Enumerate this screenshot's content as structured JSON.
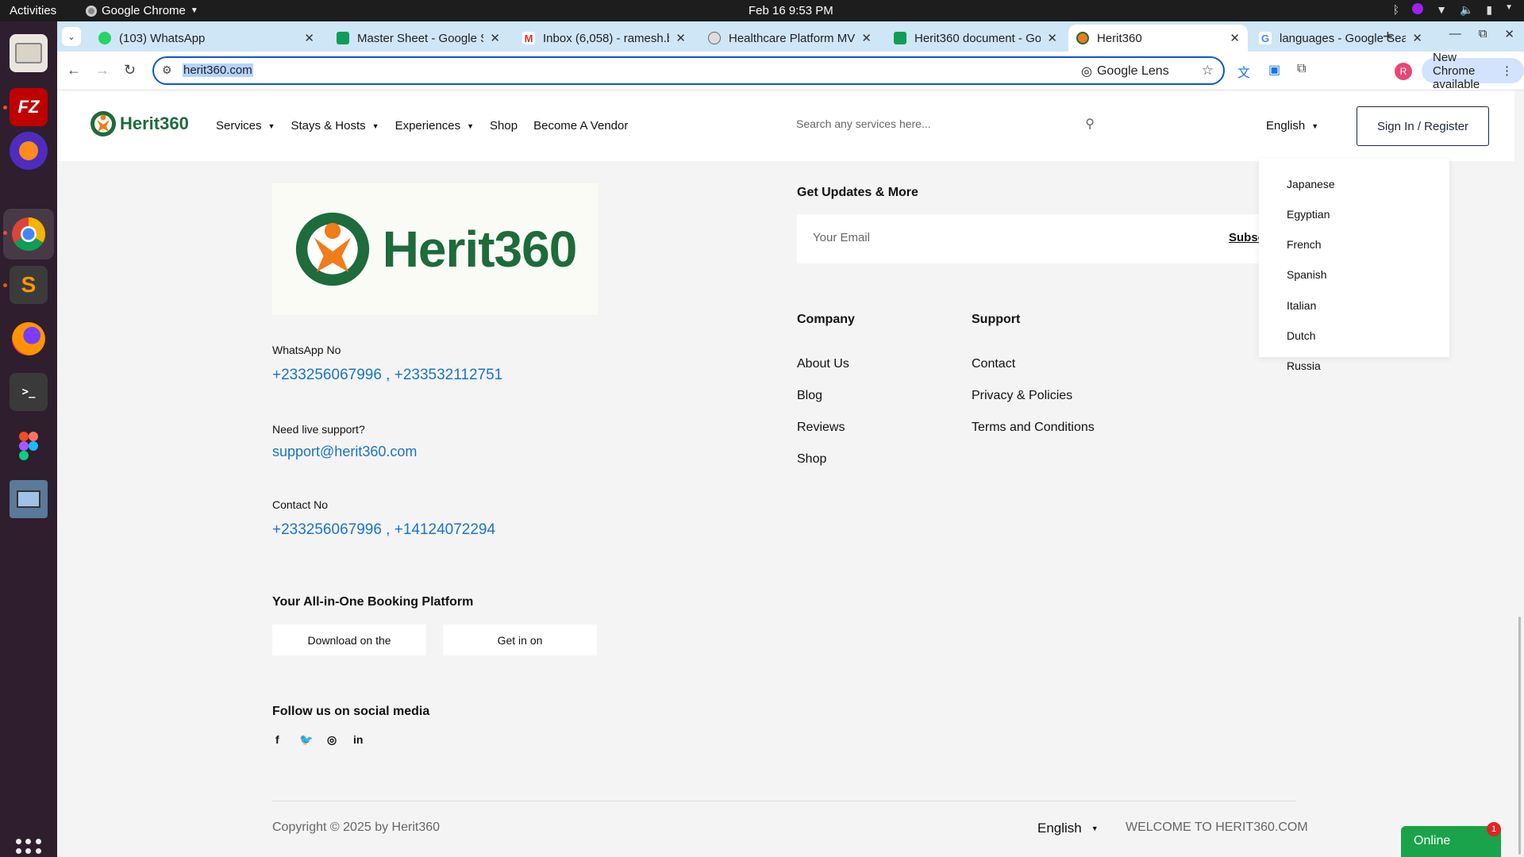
{
  "system": {
    "activities": "Activities",
    "app_name": "Google Chrome",
    "clock": "Feb 16  9:53 PM"
  },
  "dock": {
    "apps": [
      "files",
      "filezilla",
      "firefox-dev",
      "chrome",
      "sublime-text",
      "firefox",
      "terminal",
      "figma",
      "screen-recorder"
    ]
  },
  "browser": {
    "tabs": [
      {
        "title": "(103) WhatsApp",
        "icon": "whatsapp-icon",
        "active": false
      },
      {
        "title": "Master Sheet - Google S",
        "icon": "sheets-icon",
        "active": false
      },
      {
        "title": "Inbox (6,058) - ramesh.b",
        "icon": "gmail-icon",
        "active": false
      },
      {
        "title": "Healthcare Platform MV",
        "icon": "globe-icon",
        "active": false
      },
      {
        "title": "Herit360 document - Go",
        "icon": "sheets-icon",
        "active": false
      },
      {
        "title": "Herit360",
        "icon": "herit360-icon",
        "active": true
      },
      {
        "title": "languages - Google Sea",
        "icon": "google-icon",
        "active": false
      }
    ],
    "url": "herit360.com",
    "lens_label": "Google Lens",
    "profile_initial": "R",
    "new_chrome_label": "New Chrome available"
  },
  "site": {
    "brand": "Herit360",
    "nav": [
      {
        "label": "Services",
        "has_caret": true
      },
      {
        "label": "Stays & Hosts",
        "has_caret": true
      },
      {
        "label": "Experiences",
        "has_caret": true
      },
      {
        "label": "Shop",
        "has_caret": false
      },
      {
        "label": "Become A Vendor",
        "has_caret": false
      }
    ],
    "search_placeholder": "Search any services here...",
    "language": "English",
    "signin_label": "Sign In / Register",
    "logo_text": "Herit360",
    "whatsapp_label": "WhatsApp No",
    "whatsapp_numbers": "+233256067996 , +233532112751",
    "support_label": "Need live support?",
    "support_email": "support@herit360.com",
    "contact_label": "Contact No",
    "contact_numbers": "+233256067996 , +14124072294",
    "platform_title": "Your All-in-One Booking Platform",
    "download_btn": "Download on the",
    "getiton_btn": "Get in on",
    "follow_title": "Follow us on social media",
    "updates_title": "Get Updates & More",
    "email_placeholder": "Your Email",
    "subscribe_label": "Subsc",
    "company_title": "Company",
    "company_links": [
      "About Us",
      "Blog",
      "Reviews",
      "Shop"
    ],
    "support_title": "Support",
    "support_links": [
      "Contact",
      "Privacy & Policies",
      "Terms and Conditions"
    ],
    "copyright": "Copyright © 2025 by Herit360",
    "footer_language": "English",
    "welcome": "WELCOME TO HERIT360.COM",
    "language_options": [
      "Japanese",
      "Egyptian",
      "French",
      "Spanish",
      "Italian",
      "Dutch",
      "Russia"
    ],
    "online_label": "Online",
    "online_badge": "1"
  },
  "colors": {
    "brand_green": "#1e6b3c",
    "brand_orange": "#f07c1a",
    "link_blue": "#1a73c8",
    "online_green": "#1aa34a"
  }
}
